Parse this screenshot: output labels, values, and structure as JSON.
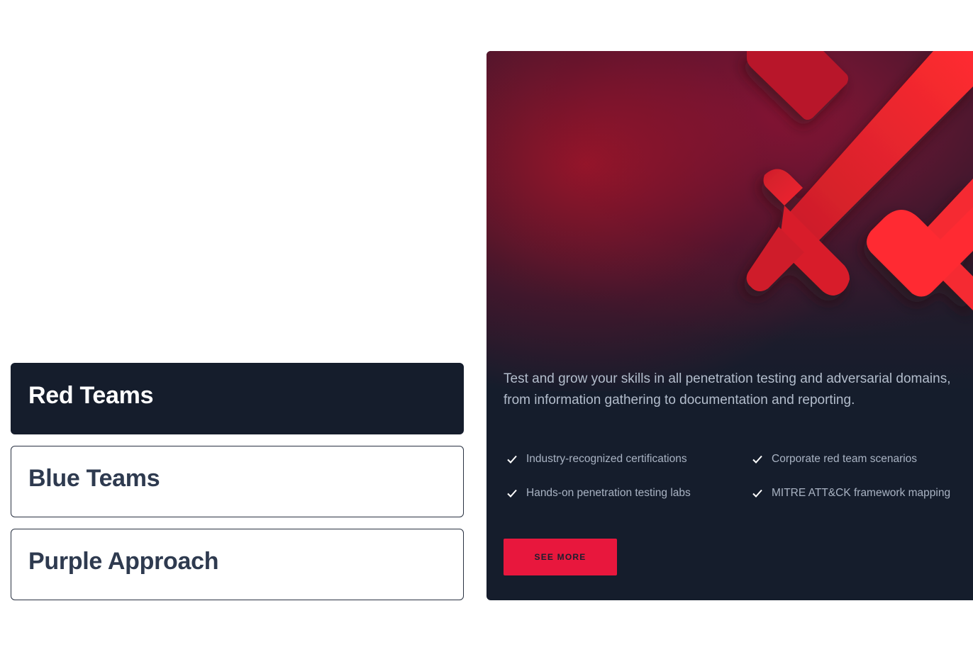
{
  "tabs": [
    {
      "label": "Red Teams",
      "active": true
    },
    {
      "label": "Blue Teams",
      "active": false
    },
    {
      "label": "Purple Approach",
      "active": false
    }
  ],
  "panel": {
    "illustration": "crossed-swords-icon",
    "description": "Test and grow your skills in all penetration testing and adversarial domains, from information gathering to documentation and reporting.",
    "features": [
      "Industry-recognized certifications",
      "Corporate red team scenarios",
      "Hands-on penetration testing labs",
      "MITRE ATT&CK framework mapping"
    ],
    "cta_label": "SEE MORE"
  },
  "colors": {
    "accent": "#e8173d",
    "dark": "#151d2c",
    "tab_inactive_text": "#2e3a4f"
  }
}
